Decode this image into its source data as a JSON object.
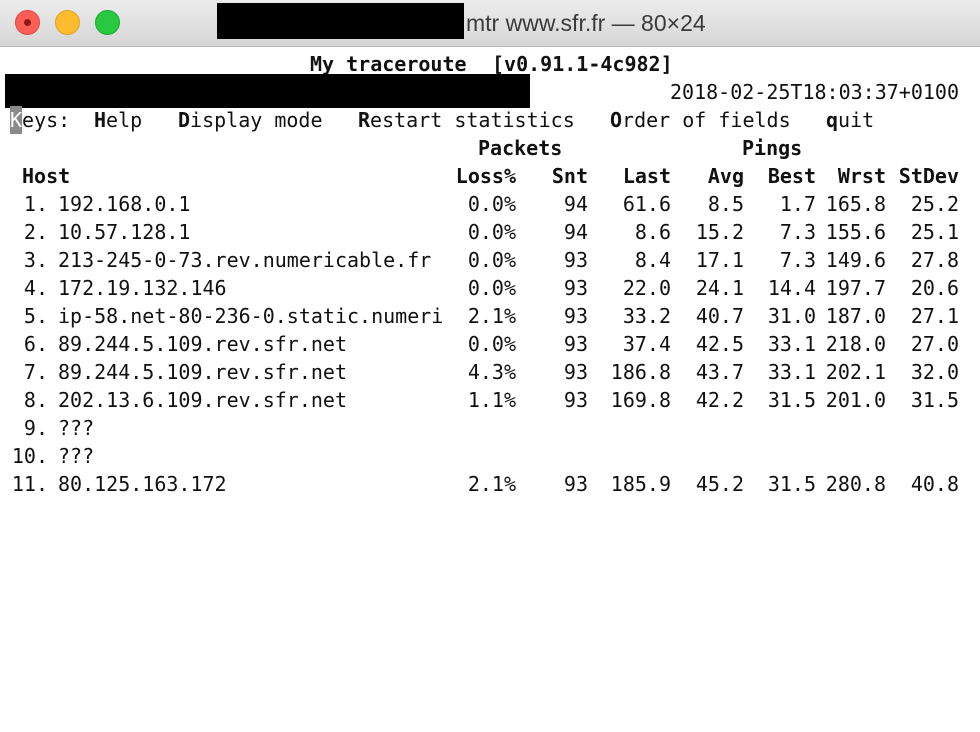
{
  "window": {
    "title": "mtr www.sfr.fr — 80×24"
  },
  "header": {
    "app_title": "My traceroute",
    "version": "[v0.91.1-4c982]",
    "timestamp": "2018-02-25T18:03:37+0100"
  },
  "keys": {
    "prefix_key": "K",
    "prefix_rest": "eys:",
    "help_key": "H",
    "help_rest": "elp",
    "display_key": "D",
    "display_rest": "isplay mode",
    "restart_key": "R",
    "restart_rest": "estart statistics",
    "order_key": "O",
    "order_rest": "rder of fields",
    "quit_key": "q",
    "quit_rest": "uit"
  },
  "table": {
    "group_packets": "Packets",
    "group_pings": "Pings",
    "headers": {
      "host": "Host",
      "loss": "Loss%",
      "snt": "Snt",
      "last": "Last",
      "avg": "Avg",
      "best": "Best",
      "wrst": "Wrst",
      "stdev": "StDev"
    },
    "rows": [
      {
        "idx": "1.",
        "host": "192.168.0.1",
        "loss": "0.0%",
        "snt": "94",
        "last": "61.6",
        "avg": "8.5",
        "best": "1.7",
        "wrst": "165.8",
        "stdev": "25.2"
      },
      {
        "idx": "2.",
        "host": "10.57.128.1",
        "loss": "0.0%",
        "snt": "94",
        "last": "8.6",
        "avg": "15.2",
        "best": "7.3",
        "wrst": "155.6",
        "stdev": "25.1"
      },
      {
        "idx": "3.",
        "host": "213-245-0-73.rev.numericable.fr",
        "loss": "0.0%",
        "snt": "93",
        "last": "8.4",
        "avg": "17.1",
        "best": "7.3",
        "wrst": "149.6",
        "stdev": "27.8"
      },
      {
        "idx": "4.",
        "host": "172.19.132.146",
        "loss": "0.0%",
        "snt": "93",
        "last": "22.0",
        "avg": "24.1",
        "best": "14.4",
        "wrst": "197.7",
        "stdev": "20.6"
      },
      {
        "idx": "5.",
        "host": "ip-58.net-80-236-0.static.numeri",
        "loss": "2.1%",
        "snt": "93",
        "last": "33.2",
        "avg": "40.7",
        "best": "31.0",
        "wrst": "187.0",
        "stdev": "27.1"
      },
      {
        "idx": "6.",
        "host": "89.244.5.109.rev.sfr.net",
        "loss": "0.0%",
        "snt": "93",
        "last": "37.4",
        "avg": "42.5",
        "best": "33.1",
        "wrst": "218.0",
        "stdev": "27.0"
      },
      {
        "idx": "7.",
        "host": "89.244.5.109.rev.sfr.net",
        "loss": "4.3%",
        "snt": "93",
        "last": "186.8",
        "avg": "43.7",
        "best": "33.1",
        "wrst": "202.1",
        "stdev": "32.0"
      },
      {
        "idx": "8.",
        "host": "202.13.6.109.rev.sfr.net",
        "loss": "1.1%",
        "snt": "93",
        "last": "169.8",
        "avg": "42.2",
        "best": "31.5",
        "wrst": "201.0",
        "stdev": "31.5"
      },
      {
        "idx": "9.",
        "host": "???",
        "loss": "",
        "snt": "",
        "last": "",
        "avg": "",
        "best": "",
        "wrst": "",
        "stdev": ""
      },
      {
        "idx": "10.",
        "host": "???",
        "loss": "",
        "snt": "",
        "last": "",
        "avg": "",
        "best": "",
        "wrst": "",
        "stdev": ""
      },
      {
        "idx": "11.",
        "host": "80.125.163.172",
        "loss": "2.1%",
        "snt": "93",
        "last": "185.9",
        "avg": "45.2",
        "best": "31.5",
        "wrst": "280.8",
        "stdev": "40.8"
      }
    ]
  }
}
